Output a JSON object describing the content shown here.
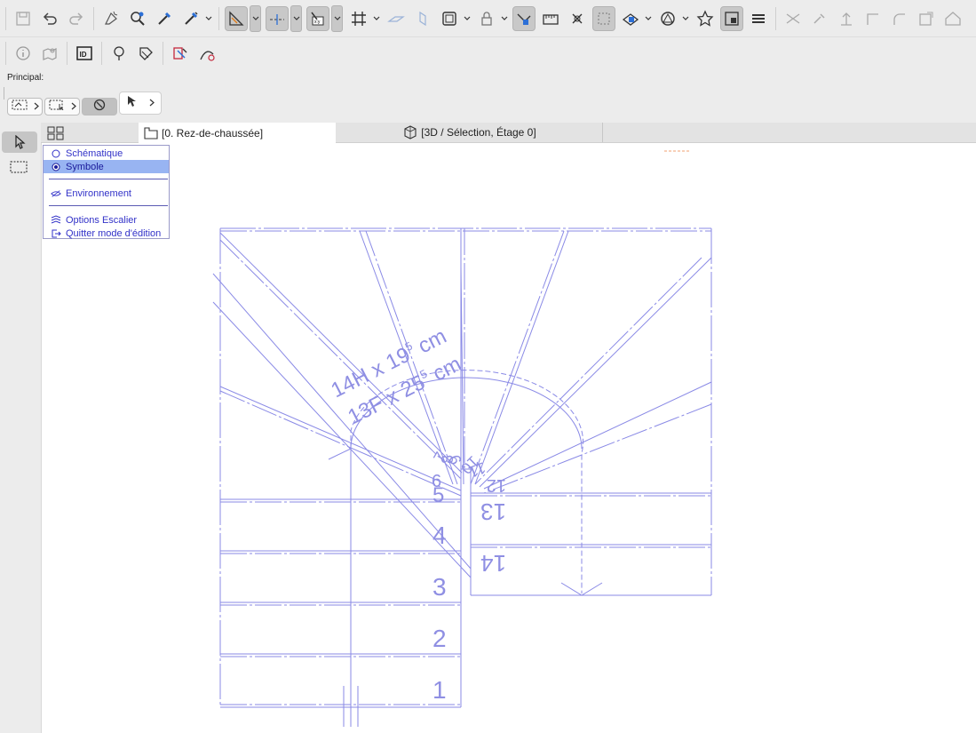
{
  "toolbar1": {
    "icons": [
      "save-icon",
      "undo-icon",
      "redo-icon",
      "magic-wand-icon",
      "find-select-icon",
      "eyedropper-icon",
      "syringe-icon",
      "guide-lines-icon",
      "snap-guides-icon",
      "coordinate-input-icon",
      "grid-snap-icon",
      "slab-gray-icon",
      "wall-gray-icon",
      "wall-frame-icon",
      "lock-icon",
      "renovation-filter-icon",
      "measure-icon",
      "cross-icon",
      "trim-icon",
      "gravity-icon",
      "polygon-icon",
      "favorites-icon",
      "view-layout-icon",
      "layers-icon",
      "split-icon",
      "adjust-icon",
      "elevate-icon",
      "offset-icon",
      "fillet-icon",
      "resize-icon",
      "house-icon"
    ]
  },
  "toolbar2": {
    "icons": [
      "info-icon",
      "map-pin-icon",
      "id-icon",
      "tree-icon",
      "tag-icon",
      "pen-tool-icon",
      "curve-tool-icon"
    ]
  },
  "info_box": {
    "principal_label": "Principal:"
  },
  "left_toolbox": {
    "icons": [
      "arrow-select-icon",
      "marquee-icon"
    ]
  },
  "tabs": [
    {
      "label": "[0. Rez-de-chaussée]",
      "icon": "floor-plan-icon",
      "active": true
    },
    {
      "label": "[3D / Sélection, Étage 0]",
      "icon": "3d-box-icon",
      "active": false
    }
  ],
  "context_menu": {
    "items": [
      {
        "label": "Schématique",
        "icon": "radio-empty-icon",
        "selected": false
      },
      {
        "label": "Symbole",
        "icon": "radio-filled-icon",
        "selected": true
      },
      {
        "label": "Environnement",
        "icon": "hidden-eye-icon",
        "selected": false
      },
      {
        "label": "Options Escalier",
        "icon": "stair-settings-icon",
        "selected": false
      },
      {
        "label": "Quitter mode d'édition",
        "icon": "exit-icon",
        "selected": false
      }
    ]
  },
  "stair": {
    "dim_rise_main": "14H x 19",
    "dim_rise_sup": "5",
    "dim_rise_unit": " cm",
    "dim_tread_main": "13F x 25",
    "dim_tread_sup": "5",
    "dim_tread_unit": " cm",
    "step_numbers": [
      "1",
      "2",
      "3",
      "4",
      "5",
      "6",
      "7",
      "8",
      "9",
      "10",
      "11",
      "12",
      "13",
      "14"
    ]
  },
  "colors": {
    "stair_line": "#8a8ae6",
    "stair_text": "#8f8fe3",
    "menu_text": "#3232c8",
    "menu_selected_bg": "#98b4f2",
    "accent_orange": "#f0a070"
  }
}
